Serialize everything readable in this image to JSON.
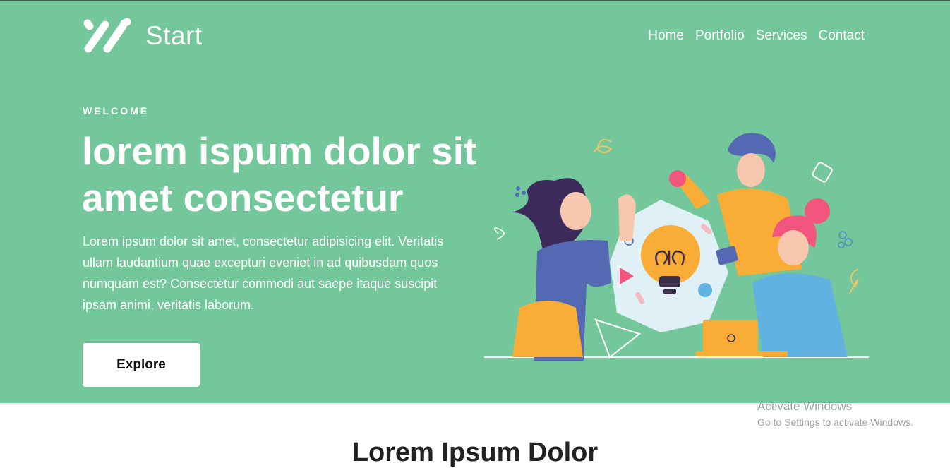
{
  "brand": {
    "name": "Start",
    "logo_icon": "three-slash-logo-icon"
  },
  "nav": {
    "items": [
      {
        "label": "Home"
      },
      {
        "label": "Portfolio"
      },
      {
        "label": "Services"
      },
      {
        "label": "Contact"
      }
    ]
  },
  "hero": {
    "eyebrow": "WELCOME",
    "headline": "lorem ispum dolor sit amet consectetur",
    "body": "Lorem ipsum dolor sit amet, consectetur adipisicing elit. Veritatis ullam laudantium quae excepturi eveniet in ad quibusdam quos numquam est? Consectetur commodi aut saepe itaque suscipit ipsam animi, veritatis laborum.",
    "cta_label": "Explore",
    "illustration_icon": "team-lightbulb-illustration"
  },
  "section": {
    "title": "Lorem Ipsum Dolor"
  },
  "os_overlay": {
    "title": "Activate Windows",
    "subtitle": "Go to Settings to activate Windows."
  },
  "colors": {
    "hero_bg": "#74c79b",
    "text_light": "#ffffff",
    "button_bg": "#ffffff",
    "accent_yellow": "#f9ad36",
    "accent_blue": "#5468b3",
    "accent_pink": "#f2557d"
  }
}
